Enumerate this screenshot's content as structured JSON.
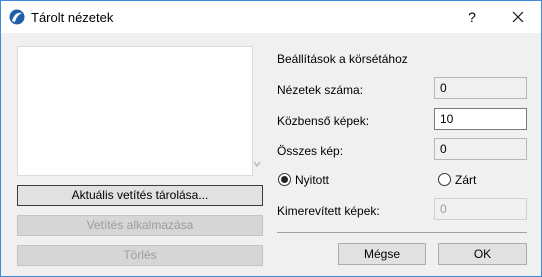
{
  "window": {
    "title": "Tárolt nézetek",
    "help": "?"
  },
  "left": {
    "store_button": "Aktuális vetítés tárolása...",
    "apply_button": "Vetítés alkalmazása",
    "delete_button": "Törlés"
  },
  "right": {
    "section_title": "Beállítások a körsétához",
    "views_count_label": "Nézetek száma:",
    "views_count_value": "0",
    "intermediate_label": "Közbenső képek:",
    "intermediate_value": "10",
    "total_label": "Összes kép:",
    "total_value": "0",
    "radio_open": {
      "label": "Nyitott",
      "selected": true
    },
    "radio_closed": {
      "label": "Zárt",
      "selected": false
    },
    "frozen_label": "Kimerevített képek:",
    "frozen_value": "0"
  },
  "footer": {
    "cancel": "Mégse",
    "ok": "OK"
  },
  "colors": {
    "accent": "#3c8ad8",
    "dialog_bg": "#f0f0f0"
  }
}
